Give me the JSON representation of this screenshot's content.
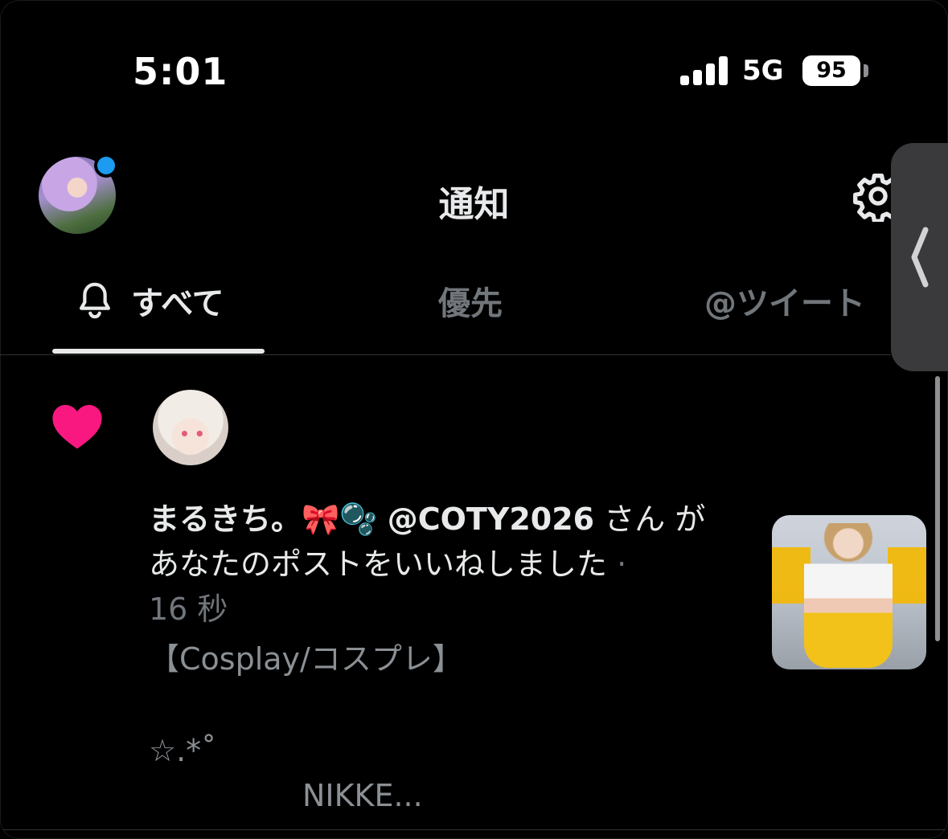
{
  "status_bar": {
    "time": "5:01",
    "network": "5G",
    "battery": "95"
  },
  "header": {
    "title": "通知"
  },
  "tabs": [
    {
      "label": "すべて",
      "active": true
    },
    {
      "label": "優先",
      "active": false
    },
    {
      "label": "@ツイート",
      "active": false
    }
  ],
  "notification": {
    "type": "like",
    "user_name": "まるきち。🎀🫧",
    "handle": "@COTY2026",
    "line1_suffix": "さん",
    "line2": "があなたのポストをいいねしました",
    "dot": "·",
    "age": "16 秒",
    "preview_line1": "【Cosplay/コスプレ】",
    "preview_line2": "☆.*˚",
    "preview_line3": "NIKKE..."
  },
  "colors": {
    "background": "#000000",
    "like_heart": "#f91880",
    "accent": "#1d9bf0",
    "muted_text": "#71767b"
  }
}
